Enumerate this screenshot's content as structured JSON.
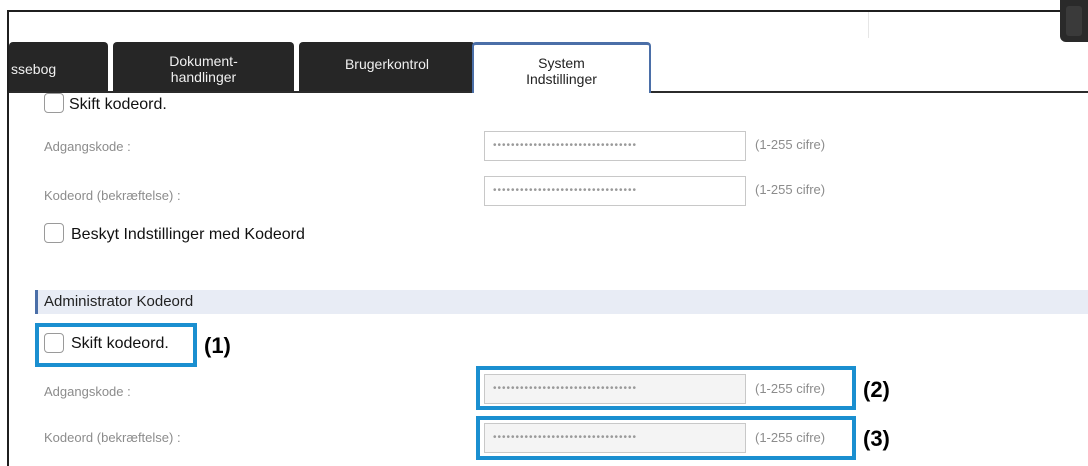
{
  "tabs": [
    {
      "id": "t1",
      "line1": "ssebog",
      "line2": ""
    },
    {
      "id": "t2",
      "line1": "Dokument-",
      "line2": "handlinger"
    },
    {
      "id": "t3",
      "line1": "Brugerkontrol",
      "line2": ""
    },
    {
      "id": "t4",
      "line1": "System",
      "line2": "Indstillinger",
      "active": true
    }
  ],
  "user_section": {
    "change_password_label": "Skift kodeord.",
    "password_label": "Adgangskode :",
    "password_value": "••••••••••••••••••••••••••••••••",
    "password_hint": "(1-255 cifre)",
    "confirm_label": "Kodeord (bekræftelse) :",
    "confirm_value": "••••••••••••••••••••••••••••••••",
    "confirm_hint": "(1-255 cifre)",
    "protect_label": "Beskyt Indstillinger med Kodeord"
  },
  "admin_section": {
    "heading": "Administrator Kodeord",
    "change_password_label": "Skift kodeord.",
    "password_label": "Adgangskode :",
    "password_value": "••••••••••••••••••••••••••••••••",
    "password_hint": "(1-255 cifre)",
    "confirm_label": "Kodeord (bekræftelse) :",
    "confirm_value": "••••••••••••••••••••••••••••••••",
    "confirm_hint": "(1-255 cifre)"
  },
  "callouts": {
    "c1": "(1)",
    "c2": "(2)",
    "c3": "(3)"
  },
  "colors": {
    "accent": "#4b6fa8",
    "callout": "#1a8fd0",
    "tab_dark": "#262626",
    "section_bg": "#e8ecf5"
  }
}
